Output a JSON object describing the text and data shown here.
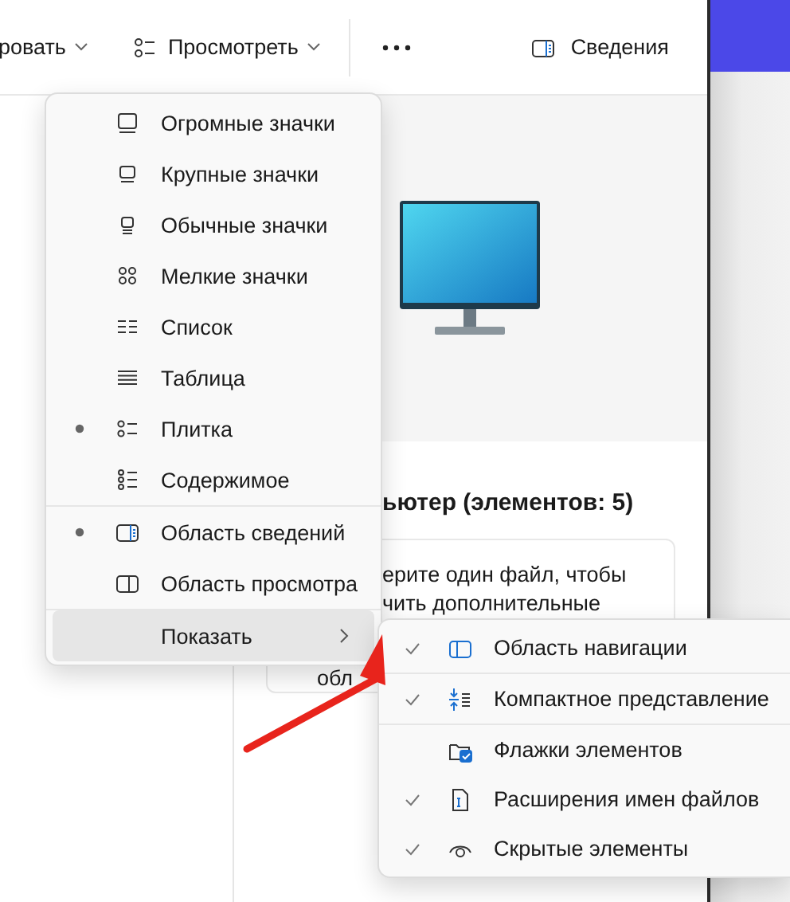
{
  "toolbar": {
    "items": [
      {
        "label": "ровать",
        "kind": "dropdown"
      },
      {
        "label": "Просмотреть",
        "kind": "dropdown"
      },
      {
        "kind": "more"
      },
      {
        "label": "Сведения",
        "kind": "button"
      }
    ]
  },
  "details": {
    "heading": "ьютер (элементов: 5)",
    "card_lines": [
      "ерите один файл, чтобы",
      "чить дополнительные",
      "обл"
    ]
  },
  "view_menu": {
    "groups": [
      [
        {
          "label": "Огромные значки",
          "kind": "item",
          "selected": false
        },
        {
          "label": "Крупные значки",
          "kind": "item",
          "selected": false
        },
        {
          "label": "Обычные значки",
          "kind": "item",
          "selected": false
        },
        {
          "label": "Мелкие значки",
          "kind": "item",
          "selected": false
        },
        {
          "label": "Список",
          "kind": "item",
          "selected": false
        },
        {
          "label": "Таблица",
          "kind": "item",
          "selected": false
        },
        {
          "label": "Плитка",
          "kind": "item",
          "selected": true
        },
        {
          "label": "Содержимое",
          "kind": "item",
          "selected": false
        }
      ],
      [
        {
          "label": "Область сведений",
          "kind": "item",
          "selected": true
        },
        {
          "label": "Область просмотра",
          "kind": "item",
          "selected": false
        }
      ],
      [
        {
          "label": "Показать",
          "kind": "submenu",
          "hovered": true
        }
      ]
    ]
  },
  "show_menu": {
    "groups": [
      [
        {
          "label": "Область навигации",
          "checked": true
        }
      ],
      [
        {
          "label": "Компактное представление",
          "checked": true
        }
      ],
      [
        {
          "label": "Флажки элементов",
          "checked": false
        },
        {
          "label": "Расширения имен файлов",
          "checked": true
        },
        {
          "label": "Скрытые элементы",
          "checked": true
        }
      ]
    ]
  },
  "annotation": {
    "kind": "arrow"
  }
}
